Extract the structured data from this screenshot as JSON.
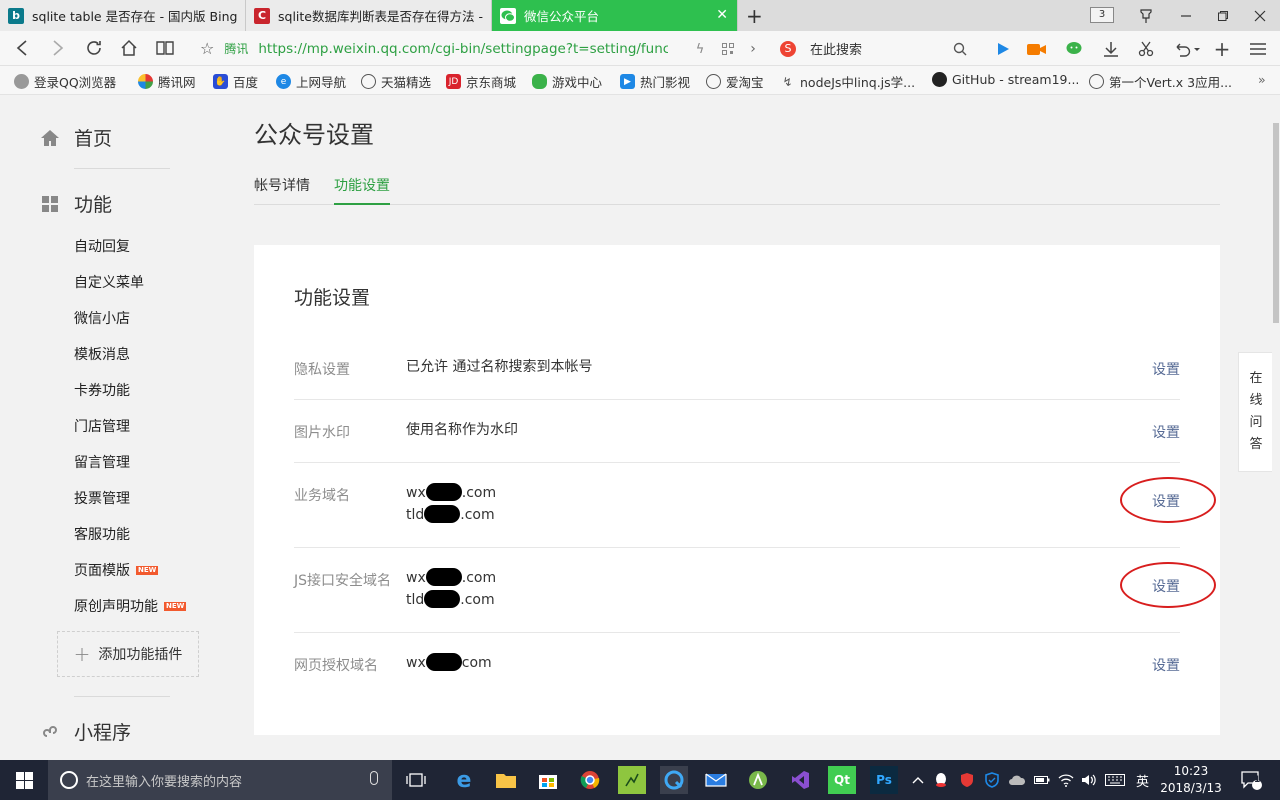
{
  "browser": {
    "tabs": [
      {
        "title": "sqlite table 是否存在 - 国内版 Bing",
        "icon": "bing-icon",
        "color": "#0b7a8b"
      },
      {
        "title": "sqlite数据库判断表是否存在得方法 -",
        "icon": "csdn-icon",
        "color": "#c9252d"
      },
      {
        "title": "微信公众平台",
        "icon": "wechat-icon",
        "color": "#2ec04f"
      }
    ],
    "tab_count": "3",
    "address": {
      "site_label": "腾讯",
      "url": "https://mp.weixin.qq.com/cgi-bin/settingpage?t=setting/function&"
    },
    "search_placeholder": "在此搜索",
    "bookmarks": [
      "登录QQ浏览器",
      "腾讯网",
      "百度",
      "上网导航",
      "天猫精选",
      "京东商城",
      "游戏中心",
      "热门影视",
      "爱淘宝",
      "nodeJs中linq.js学...",
      "GitHub - stream19...",
      "第一个Vert.x 3应用..."
    ],
    "bookmarks_more": "»"
  },
  "sidebar": {
    "home": "首页",
    "functions": "功能",
    "items": [
      {
        "label": "自动回复",
        "new": false
      },
      {
        "label": "自定义菜单",
        "new": false
      },
      {
        "label": "微信小店",
        "new": false
      },
      {
        "label": "模板消息",
        "new": false
      },
      {
        "label": "卡券功能",
        "new": false
      },
      {
        "label": "门店管理",
        "new": false
      },
      {
        "label": "留言管理",
        "new": false
      },
      {
        "label": "投票管理",
        "new": false
      },
      {
        "label": "客服功能",
        "new": false
      },
      {
        "label": "页面模版",
        "new": true
      },
      {
        "label": "原创声明功能",
        "new": true
      }
    ],
    "new_badge": "NEW",
    "add_plugin": "添加功能插件",
    "mini_program": "小程序"
  },
  "main": {
    "title": "公众号设置",
    "tabs": [
      {
        "label": "帐号详情",
        "active": false
      },
      {
        "label": "功能设置",
        "active": true
      }
    ],
    "card_title": "功能设置",
    "rows": [
      {
        "label": "隐私设置",
        "values": [
          "已允许 通过名称搜索到本帐号"
        ],
        "action": "设置",
        "circled": false
      },
      {
        "label": "图片水印",
        "values": [
          "使用名称作为水印"
        ],
        "action": "设置",
        "circled": false
      },
      {
        "label": "业务域名",
        "values": [
          {
            "prefix": "wx",
            "suffix": ".com"
          },
          {
            "prefix": "tld",
            "suffix": ".com"
          }
        ],
        "action": "设置",
        "circled": true
      },
      {
        "label": "JS接口安全域名",
        "values": [
          {
            "prefix": "wx",
            "suffix": ".com"
          },
          {
            "prefix": "tld",
            "suffix": ".com"
          }
        ],
        "action": "设置",
        "circled": true
      },
      {
        "label": "网页授权域名",
        "values": [
          {
            "prefix": "wx",
            "suffix": "com"
          }
        ],
        "action": "设置",
        "circled": false
      }
    ]
  },
  "help_float": [
    "在",
    "线",
    "问",
    "答"
  ],
  "taskbar": {
    "search_placeholder": "在这里输入你要搜索的内容",
    "ime": "英",
    "time": "10:23",
    "date": "2018/3/13",
    "notification_count": "1"
  },
  "colors": {
    "accent_green": "#2ea043",
    "link_blue": "#576b95",
    "annotation_red": "#d81e1e",
    "new_badge": "#f25a2e"
  }
}
